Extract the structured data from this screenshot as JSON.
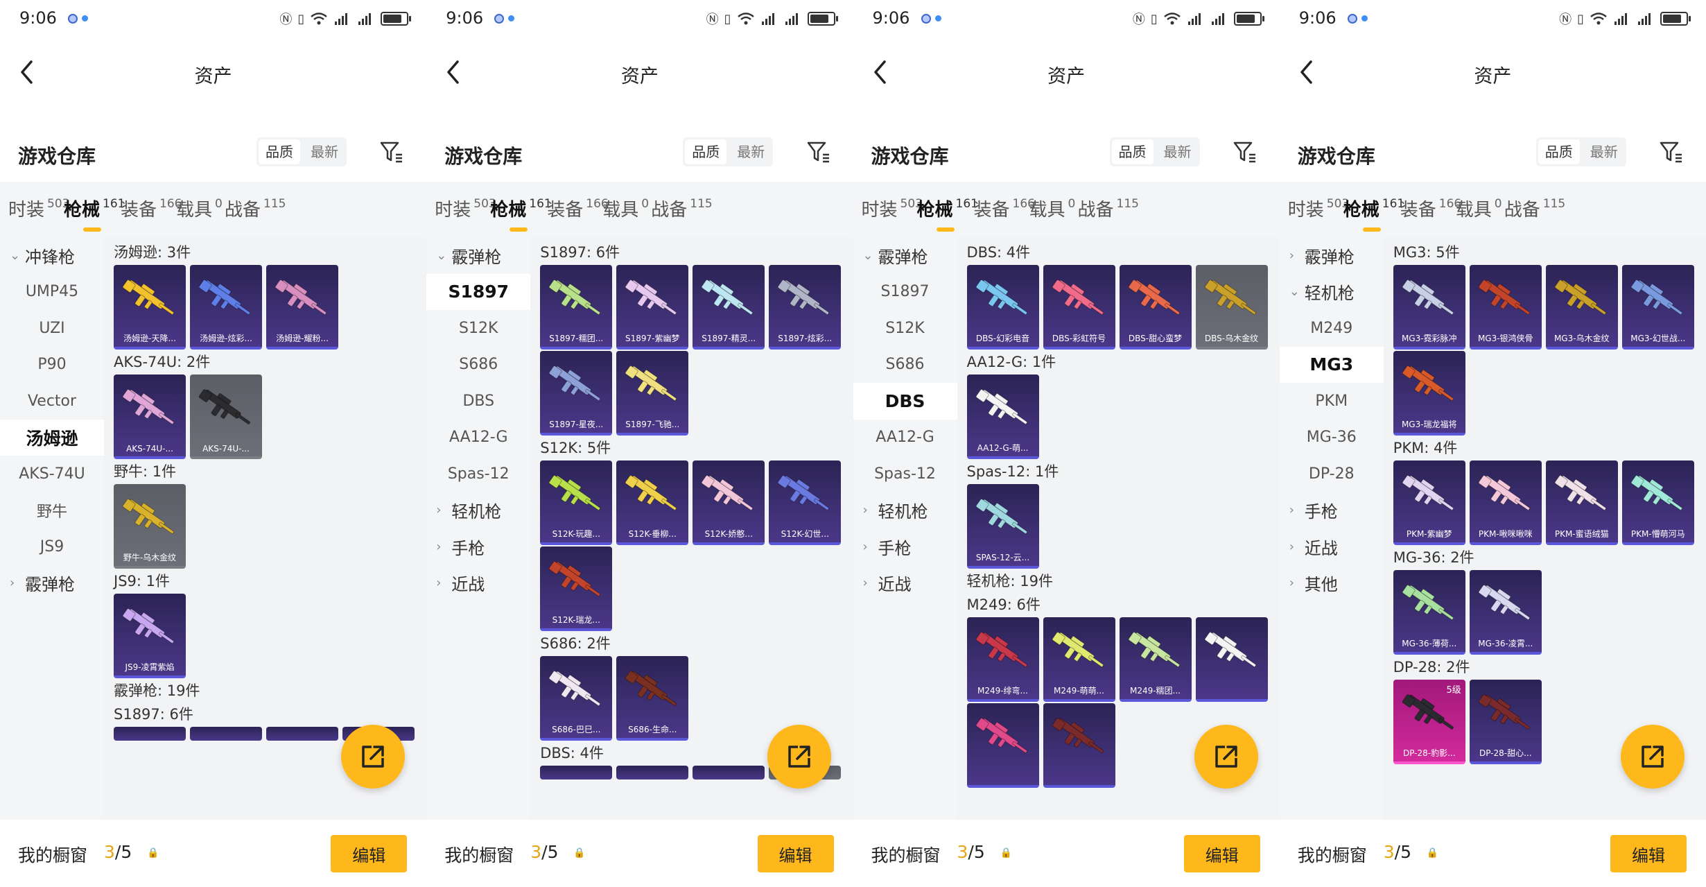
{
  "status_bar": {
    "time": "9:06"
  },
  "header": {
    "title": "资产"
  },
  "warehouse": {
    "title": "游戏仓库",
    "sort_quality": "品质",
    "sort_newest": "最新"
  },
  "tabs": [
    {
      "label": "时装",
      "count": "503"
    },
    {
      "label": "枪械",
      "count": "161"
    },
    {
      "label": "装备",
      "count": "166"
    },
    {
      "label": "载具",
      "count": "0"
    },
    {
      "label": "战备",
      "count": "115"
    }
  ],
  "bottom_bar": {
    "label": "我的橱窗",
    "used": "3",
    "total": "/5",
    "edit_label": "编辑"
  },
  "colors": {
    "accent": "#ffb81c",
    "card_bg": "#3d2f72",
    "card_border": "#5a58d8"
  },
  "screens": [
    {
      "side": [
        {
          "label": "冲锋枪",
          "group": true,
          "open": true
        },
        {
          "label": "UMP45"
        },
        {
          "label": "UZI"
        },
        {
          "label": "P90"
        },
        {
          "label": "Vector"
        },
        {
          "label": "汤姆逊",
          "selected": true
        },
        {
          "label": "AKS-74U"
        },
        {
          "label": "野牛"
        },
        {
          "label": "JS9"
        },
        {
          "label": "霰弹枪",
          "group": true,
          "open": false
        }
      ],
      "content": [
        {
          "type": "section",
          "title": "汤姆逊: 3件"
        },
        {
          "type": "cards",
          "items": [
            {
              "label": "汤姆逊-天降...",
              "color": "#f2c12e"
            },
            {
              "label": "汤姆逊-炫彩...",
              "color": "#5f7fe8"
            },
            {
              "label": "汤姆逊-耀粉...",
              "color": "#d88fc0"
            }
          ]
        },
        {
          "type": "section",
          "title": "AKS-74U: 2件"
        },
        {
          "type": "cards",
          "items": [
            {
              "label": "AKS-74U-...",
              "color": "#e0a6d8"
            },
            {
              "label": "AKS-74U-...",
              "color": "#2c2c30",
              "style": "gray"
            }
          ]
        },
        {
          "type": "section",
          "title": "野牛: 1件"
        },
        {
          "type": "cards",
          "items": [
            {
              "label": "野牛-乌木金纹",
              "color": "#d8b22c",
              "style": "gray"
            }
          ]
        },
        {
          "type": "section",
          "title": "JS9: 1件"
        },
        {
          "type": "cards",
          "items": [
            {
              "label": "JS9-凌霄紫焰",
              "color": "#c8a6f0"
            }
          ]
        },
        {
          "type": "section",
          "title": "霰弹枪: 19件"
        },
        {
          "type": "section",
          "title": "S1897: 6件"
        },
        {
          "type": "cards",
          "cut": true,
          "items": [
            {
              "label": "",
              "color": "#999"
            },
            {
              "label": "",
              "color": "#999"
            },
            {
              "label": "",
              "color": "#999"
            },
            {
              "label": "",
              "color": "#999"
            }
          ]
        }
      ]
    },
    {
      "side": [
        {
          "label": "霰弹枪",
          "group": true,
          "open": true
        },
        {
          "label": "S1897",
          "selected": true
        },
        {
          "label": "S12K"
        },
        {
          "label": "S686"
        },
        {
          "label": "DBS"
        },
        {
          "label": "AA12-G"
        },
        {
          "label": "Spas-12"
        },
        {
          "label": "轻机枪",
          "group": true,
          "open": false
        },
        {
          "label": "手枪",
          "group": true,
          "open": false
        },
        {
          "label": "近战",
          "group": true,
          "open": false
        }
      ],
      "content": [
        {
          "type": "section",
          "title": "S1897: 6件"
        },
        {
          "type": "cards",
          "items": [
            {
              "label": "S1897-糯团...",
              "color": "#b9e08a"
            },
            {
              "label": "S1897-紫幽梦",
              "color": "#e6c8f0"
            },
            {
              "label": "S1897-精灵...",
              "color": "#bde6f2"
            },
            {
              "label": "S1897-炫彩...",
              "color": "#b0b6c8"
            }
          ]
        },
        {
          "type": "cards",
          "items": [
            {
              "label": "S1897-星夜...",
              "color": "#8ea0d8"
            },
            {
              "label": "S1897-飞驰...",
              "color": "#f0e080"
            }
          ]
        },
        {
          "type": "section",
          "title": "S12K: 5件"
        },
        {
          "type": "cards",
          "items": [
            {
              "label": "S12K-玩趣...",
              "color": "#b8e04a"
            },
            {
              "label": "S12K-垂柳...",
              "color": "#f0cf4a"
            },
            {
              "label": "S12K-娇憨...",
              "color": "#f2c6d8"
            },
            {
              "label": "S12K-幻世...",
              "color": "#6a7ae0"
            }
          ]
        },
        {
          "type": "cards",
          "items": [
            {
              "label": "S12K-瑞龙...",
              "color": "#c2442a"
            }
          ]
        },
        {
          "type": "section",
          "title": "S686: 2件"
        },
        {
          "type": "cards",
          "items": [
            {
              "label": "S686-巴巳...",
              "color": "#f0e8f0"
            },
            {
              "label": "S686-生命...",
              "color": "#7a3020"
            }
          ]
        },
        {
          "type": "section",
          "title": "DBS: 4件"
        },
        {
          "type": "cards",
          "cut": true,
          "items": [
            {
              "label": "",
              "color": "#999"
            },
            {
              "label": "",
              "color": "#999"
            },
            {
              "label": "",
              "color": "#999"
            },
            {
              "label": "",
              "color": "#999",
              "style": "gray"
            }
          ]
        }
      ]
    },
    {
      "side": [
        {
          "label": "霰弹枪",
          "group": true,
          "open": true
        },
        {
          "label": "S1897"
        },
        {
          "label": "S12K"
        },
        {
          "label": "S686"
        },
        {
          "label": "DBS",
          "selected": true
        },
        {
          "label": "AA12-G"
        },
        {
          "label": "Spas-12"
        },
        {
          "label": "轻机枪",
          "group": true,
          "open": false
        },
        {
          "label": "手枪",
          "group": true,
          "open": false
        },
        {
          "label": "近战",
          "group": true,
          "open": false
        }
      ],
      "content": [
        {
          "type": "section",
          "title": "DBS: 4件"
        },
        {
          "type": "cards",
          "items": [
            {
              "label": "DBS-幻彩电音",
              "color": "#7ac6f0"
            },
            {
              "label": "DBS-彩虹符号",
              "color": "#f06a8a"
            },
            {
              "label": "DBS-甜心蛮梦",
              "color": "#e86a4a"
            },
            {
              "label": "DBS-乌木金纹",
              "color": "#c8a02a",
              "style": "gray"
            }
          ]
        },
        {
          "type": "section",
          "title": "AA12-G: 1件"
        },
        {
          "type": "cards",
          "items": [
            {
              "label": "AA12-G-萌...",
              "color": "#f4f4f4"
            }
          ]
        },
        {
          "type": "section",
          "title": "Spas-12: 1件"
        },
        {
          "type": "cards",
          "items": [
            {
              "label": "SPAS-12-云...",
              "color": "#a0d8e0"
            }
          ]
        },
        {
          "type": "section",
          "title": "轻机枪: 19件"
        },
        {
          "type": "section",
          "title": "M249: 6件"
        },
        {
          "type": "cards",
          "items": [
            {
              "label": "M249-绯弯...",
              "color": "#c8384a"
            },
            {
              "label": "M249-萌萌...",
              "color": "#e0e870"
            },
            {
              "label": "M249-糯团...",
              "color": "#c8e6a0"
            },
            {
              "label": "",
              "color": "#f4f4f4"
            }
          ]
        },
        {
          "type": "cards",
          "items": [
            {
              "label": "",
              "color": "#e04a8a"
            },
            {
              "label": "",
              "color": "#7a2a2a"
            }
          ]
        }
      ]
    },
    {
      "side": [
        {
          "label": "霰弹枪",
          "group": true,
          "open": false
        },
        {
          "label": "轻机枪",
          "group": true,
          "open": true
        },
        {
          "label": "M249"
        },
        {
          "label": "MG3",
          "selected": true
        },
        {
          "label": "PKM"
        },
        {
          "label": "MG-36"
        },
        {
          "label": "DP-28"
        },
        {
          "label": "手枪",
          "group": true,
          "open": false
        },
        {
          "label": "近战",
          "group": true,
          "open": false
        },
        {
          "label": "其他",
          "group": true,
          "open": false
        }
      ],
      "content": [
        {
          "type": "section",
          "title": "MG3: 5件"
        },
        {
          "type": "cards",
          "items": [
            {
              "label": "MG3-霓彩脉冲",
              "color": "#c8d0e8"
            },
            {
              "label": "MG3-银鸿侠骨",
              "color": "#c2442a"
            },
            {
              "label": "MG3-乌木金纹",
              "color": "#c8a02a"
            },
            {
              "label": "MG3-幻世战...",
              "color": "#7a9ae0"
            }
          ]
        },
        {
          "type": "cards",
          "items": [
            {
              "label": "MG3-瑞龙福将",
              "color": "#d85a2a"
            }
          ]
        },
        {
          "type": "section",
          "title": "PKM: 4件"
        },
        {
          "type": "cards",
          "items": [
            {
              "label": "PKM-紫幽梦",
              "color": "#e0d4f0"
            },
            {
              "label": "PKM-啾咪啾咪",
              "color": "#f4c8d8"
            },
            {
              "label": "PKM-蜜语绒猫",
              "color": "#f0e0e8"
            },
            {
              "label": "PKM-懵萌河马",
              "color": "#a0e8d8"
            }
          ]
        },
        {
          "type": "section",
          "title": "MG-36: 2件"
        },
        {
          "type": "cards",
          "items": [
            {
              "label": "MG-36-薄荷...",
              "color": "#a8e0a0"
            },
            {
              "label": "MG-36-凌霄...",
              "color": "#d8d8f0"
            }
          ]
        },
        {
          "type": "section",
          "title": "DP-28: 2件"
        },
        {
          "type": "cards",
          "items": [
            {
              "label": "DP-28-豹影...",
              "color": "#2a2a30",
              "style": "pink",
              "level": "5级"
            },
            {
              "label": "DP-28-甜心...",
              "color": "#7a2a2a"
            }
          ]
        }
      ]
    }
  ]
}
